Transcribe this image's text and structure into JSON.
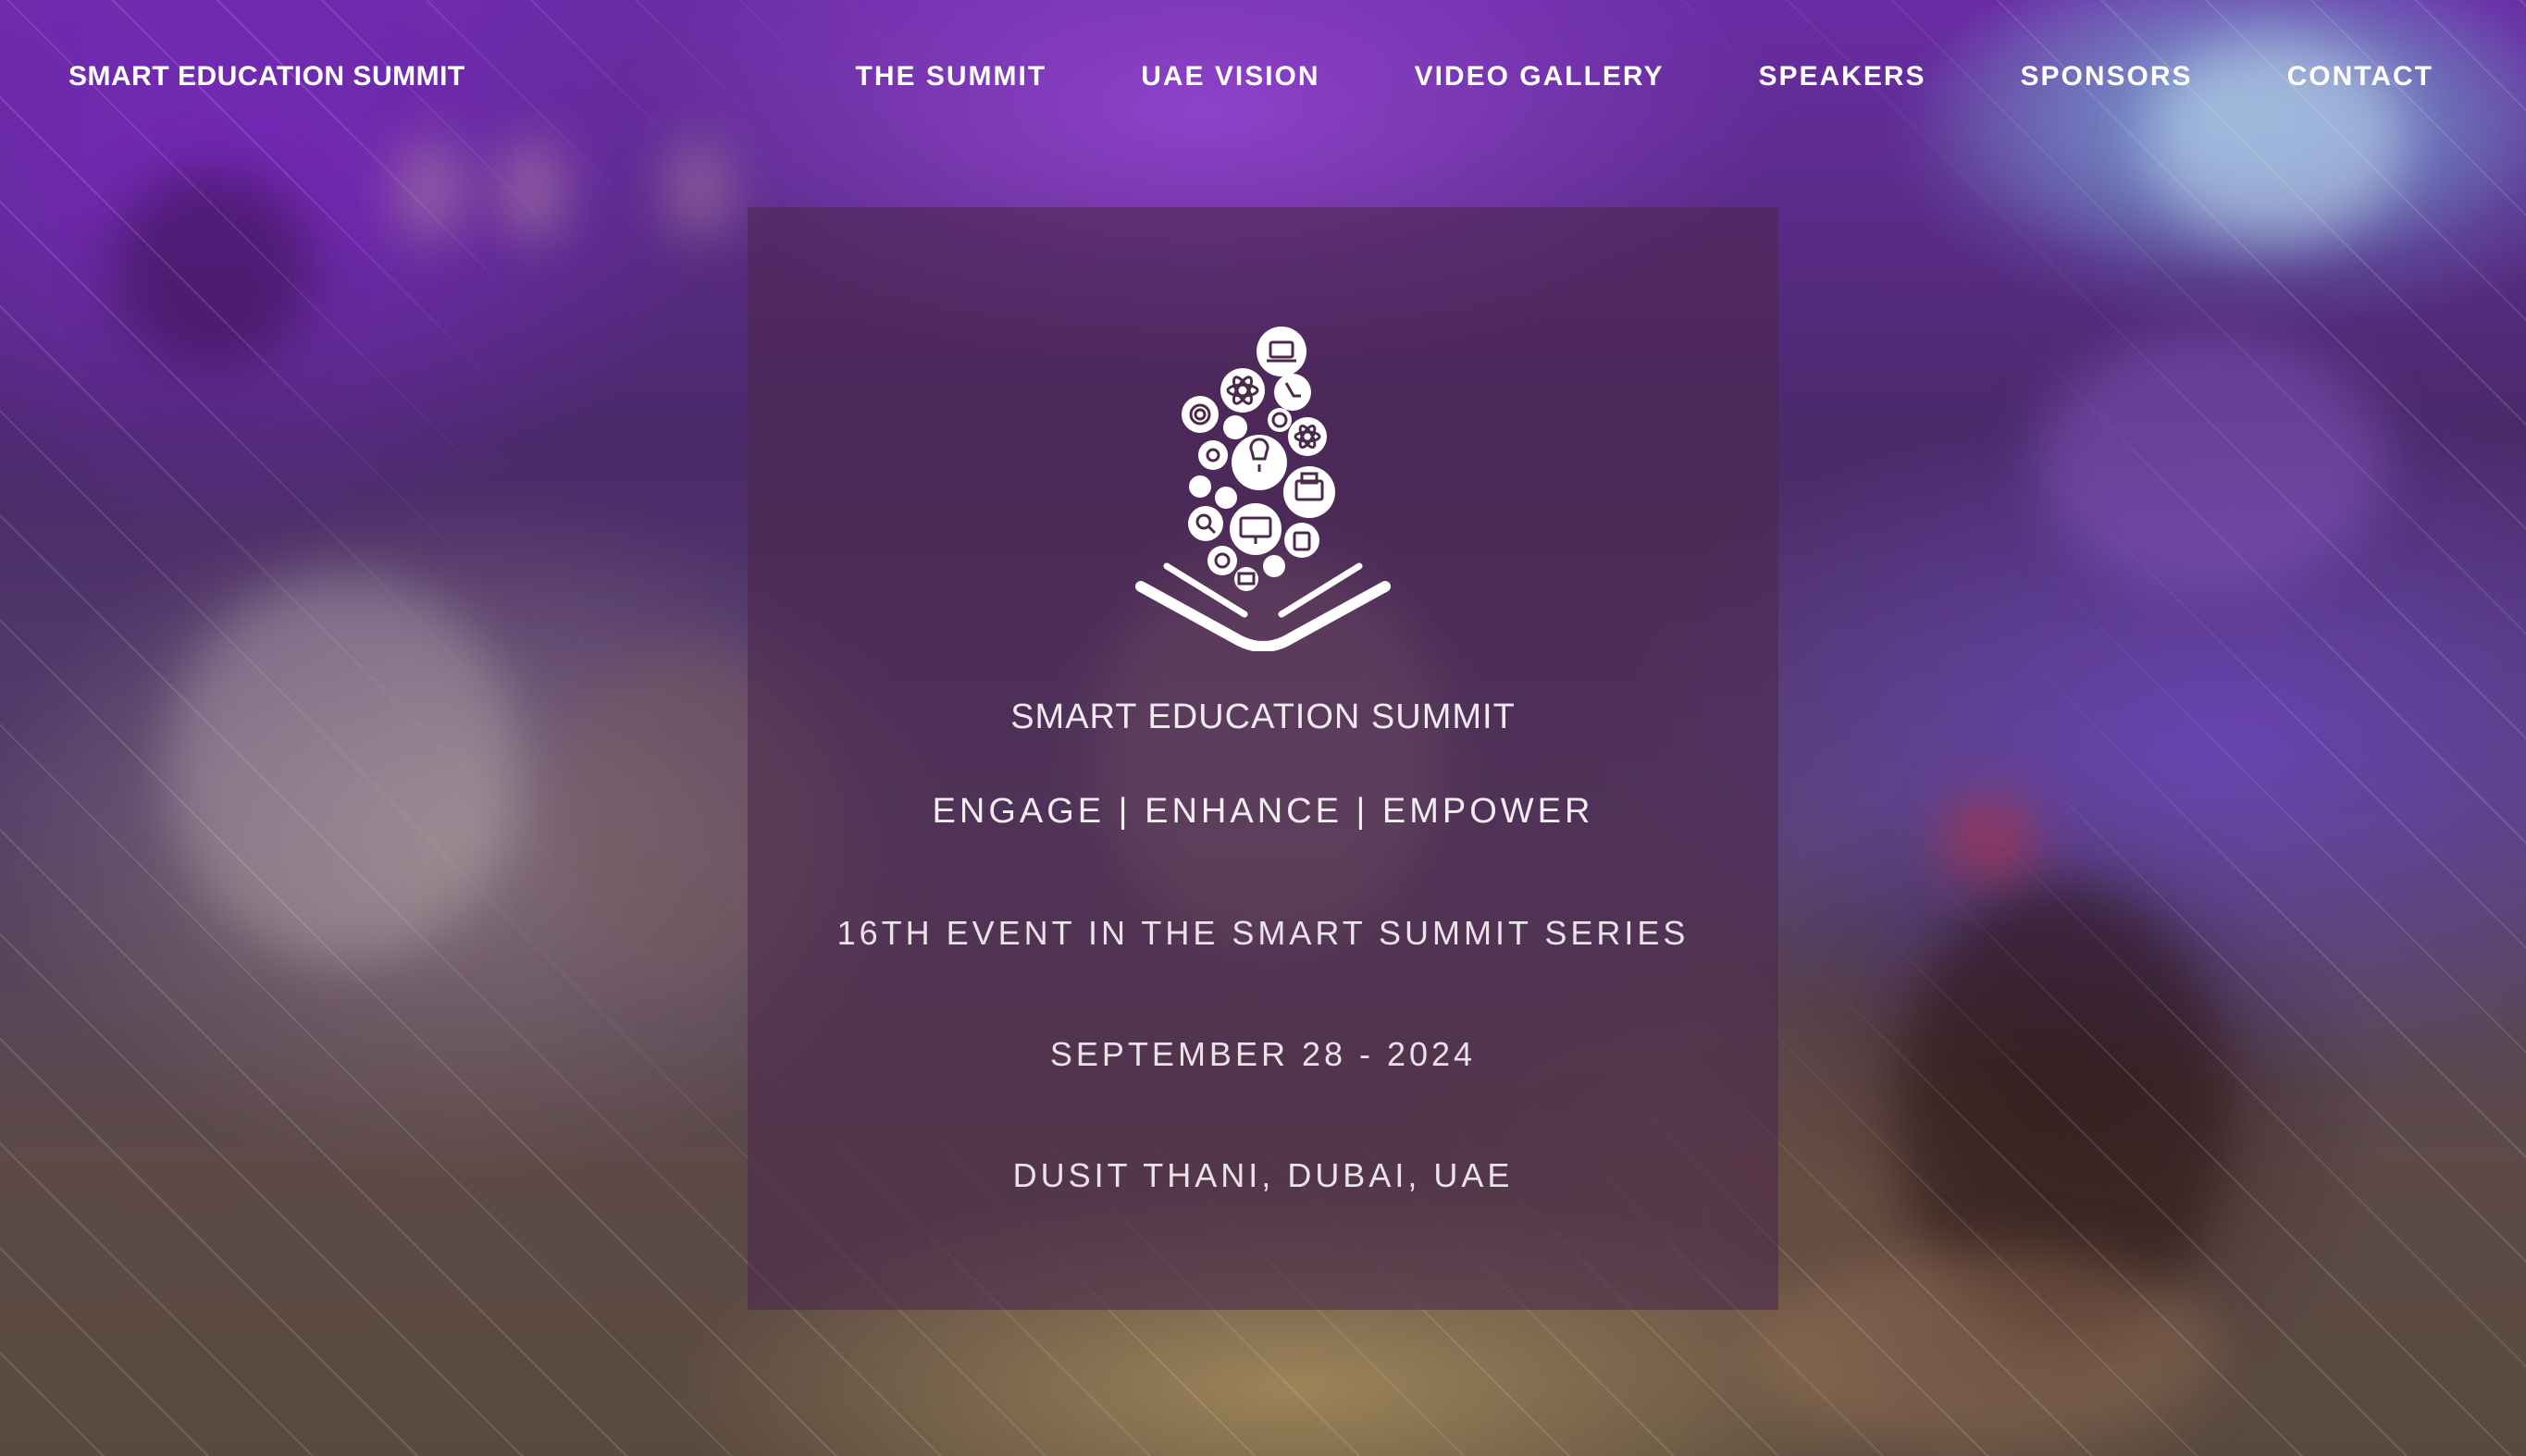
{
  "nav": {
    "brand": "SMART EDUCATION SUMMIT",
    "items": [
      {
        "label": "THE SUMMIT"
      },
      {
        "label": "UAE VISION"
      },
      {
        "label": "VIDEO GALLERY"
      },
      {
        "label": "SPEAKERS"
      },
      {
        "label": "SPONSORS"
      },
      {
        "label": "CONTACT"
      }
    ]
  },
  "hero": {
    "logo_icon": "book-with-education-icons-logo",
    "title": "SMART EDUCATION SUMMIT",
    "tagline": "ENGAGE | ENHANCE | EMPOWER",
    "series": "16TH EVENT IN THE SMART SUMMIT SERIES",
    "date": "SEPTEMBER 28 - 2024",
    "venue": "DUSIT THANI, DUBAI, UAE"
  },
  "colors": {
    "text": "#ffffff",
    "card_overlay": "rgba(75,40,75,0.58)",
    "background_accent": "#6a2ca5"
  }
}
